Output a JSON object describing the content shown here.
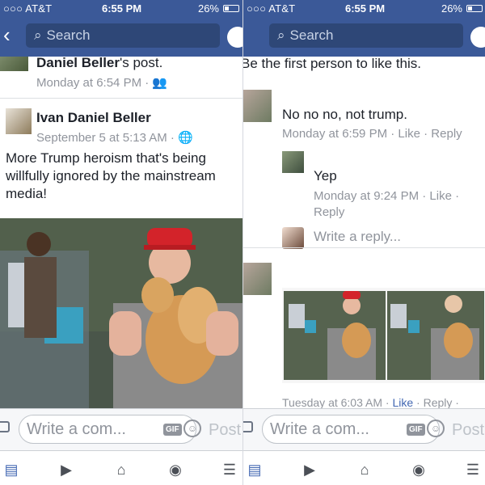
{
  "status_bar": {
    "carrier": "○○○ AT&T",
    "time": "6:55 PM",
    "battery": "26%"
  },
  "search": {
    "placeholder": "Search"
  },
  "left": {
    "shared_from": {
      "name": "Daniel Beller",
      "suffix": "'s post.",
      "time": "Monday at 6:54 PM",
      "privacy_icon": "friends-icon"
    },
    "post": {
      "author": "Ivan Daniel Beller",
      "time": "September 5 at 5:13 AM",
      "privacy_icon": "globe-icon",
      "text": "More Trump heroism that's being willfully ignored by the mainstream media!"
    }
  },
  "right": {
    "likes_line": "Be the first person to like this.",
    "comments": [
      {
        "text": "No no no, not trump.",
        "time": "Monday at 6:59 PM",
        "like": "Like",
        "reply": "Reply"
      },
      {
        "text": "Yep",
        "time": "Monday at 9:24 PM",
        "like": "Like",
        "reply": "Reply"
      }
    ],
    "reply_placeholder": "Write a reply...",
    "image_comment": {
      "time": "Tuesday at 6:03 AM",
      "like": "Like",
      "reply": "Reply"
    }
  },
  "composer": {
    "placeholder": "Write a com...",
    "gif": "GIF",
    "post": "Post"
  },
  "tabs": [
    "news-feed-icon",
    "video-icon",
    "marketplace-icon",
    "globe-icon",
    "menu-icon"
  ],
  "colors": {
    "brand": "#3b5998",
    "link": "#4267b2",
    "meta": "#90949c"
  }
}
